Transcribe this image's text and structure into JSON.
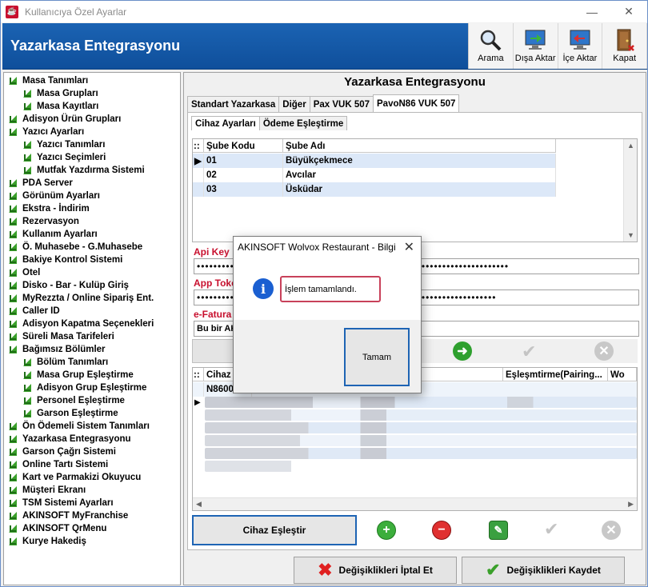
{
  "window": {
    "title": "Kullanıcıya Özel Ayarlar"
  },
  "header": {
    "title": "Yazarkasa Entegrasyonu"
  },
  "toolbar": {
    "search": "Arama",
    "export": "Dışa Aktar",
    "import": "İçe Aktar",
    "close": "Kapat"
  },
  "tree": [
    {
      "label": "Masa Tanımları",
      "level": 0
    },
    {
      "label": "Masa Grupları",
      "level": 1
    },
    {
      "label": "Masa Kayıtları",
      "level": 1
    },
    {
      "label": "Adisyon Ürün Grupları",
      "level": 0
    },
    {
      "label": "Yazıcı Ayarları",
      "level": 0
    },
    {
      "label": "Yazıcı Tanımları",
      "level": 1
    },
    {
      "label": "Yazıcı Seçimleri",
      "level": 1
    },
    {
      "label": "Mutfak Yazdırma Sistemi",
      "level": 1
    },
    {
      "label": "PDA Server",
      "level": 0
    },
    {
      "label": "Görünüm Ayarları",
      "level": 0
    },
    {
      "label": "Ekstra - İndirim",
      "level": 0
    },
    {
      "label": "Rezervasyon",
      "level": 0
    },
    {
      "label": "Kullanım Ayarları",
      "level": 0
    },
    {
      "label": "Ö. Muhasebe - G.Muhasebe",
      "level": 0
    },
    {
      "label": "Bakiye Kontrol Sistemi",
      "level": 0
    },
    {
      "label": "Otel",
      "level": 0
    },
    {
      "label": "Disko - Bar - Kulüp Giriş",
      "level": 0
    },
    {
      "label": "MyRezzta / Online Sipariş Ent.",
      "level": 0
    },
    {
      "label": "Caller ID",
      "level": 0
    },
    {
      "label": "Adisyon Kapatma Seçenekleri",
      "level": 0
    },
    {
      "label": "Süreli Masa Tarifeleri",
      "level": 0
    },
    {
      "label": "Bağımsız Bölümler",
      "level": 0
    },
    {
      "label": "Bölüm Tanımları",
      "level": 1
    },
    {
      "label": "Masa Grup Eşleştirme",
      "level": 1
    },
    {
      "label": "Adisyon Grup Eşleştirme",
      "level": 1
    },
    {
      "label": "Personel Eşleştirme",
      "level": 1
    },
    {
      "label": "Garson Eşleştirme",
      "level": 1
    },
    {
      "label": "Ön Ödemeli Sistem Tanımları",
      "level": 0
    },
    {
      "label": "Yazarkasa Entegrasyonu",
      "level": 0
    },
    {
      "label": "Garson Çağrı Sistemi",
      "level": 0
    },
    {
      "label": "Online Tartı Sistemi",
      "level": 0
    },
    {
      "label": "Kart ve Parmakizi Okuyucu",
      "level": 0
    },
    {
      "label": "Müşteri Ekranı",
      "level": 0
    },
    {
      "label": "TSM Sistemi Ayarları",
      "level": 0
    },
    {
      "label": "AKINSOFT MyFranchise",
      "level": 0
    },
    {
      "label": "AKINSOFT QrMenu",
      "level": 0
    },
    {
      "label": "Kurye Hakediş",
      "level": 0
    }
  ],
  "main": {
    "title": "Yazarkasa Entegrasyonu",
    "tabs": [
      "Standart Yazarkasa",
      "Diğer",
      "Pax VUK 507",
      "PavoN86 VUK 507"
    ],
    "subtabs": [
      "Cihaz Ayarları",
      "Ödeme Eşleştirme"
    ],
    "grid1": {
      "marker": "::",
      "columns": [
        "Şube Kodu",
        "Şube Adı"
      ],
      "rows": [
        [
          "01",
          "Büyükçekmece"
        ],
        [
          "02",
          "Avcılar"
        ],
        [
          "03",
          "Üsküdar"
        ]
      ]
    },
    "api_key_label": "Api Key",
    "api_key_value": "•••••••••••••••••••••••••••••••••••••••••••••••••••••••••••••••••••••••••••",
    "app_token_label": "App Toke",
    "app_token_value": "••••••••••••••••••••••••••••••••••••••••••••••••••••••••••••••••••••••••",
    "efatura_label": "e-Fatura",
    "efatura_value": "Bu bir AK",
    "grid2": {
      "marker": "::",
      "columns": [
        "Cihaz S",
        "Eşleşmtirme(Pairing...",
        "Wo"
      ],
      "first_cell": "N8600"
    },
    "pair_button": "Cihaz Eşleştir",
    "cancel_button": "Değişiklikleri İptal Et",
    "save_button": "Değişiklikleri Kaydet"
  },
  "dialog": {
    "title": "AKINSOFT Wolvox Restaurant - Bilgi",
    "close": "✕",
    "icon": "i",
    "message": "İşlem tamamlandı.",
    "ok": "Tamam"
  },
  "colors": {
    "header": "#1b63b3",
    "accent": "#c8102e",
    "selection": "#dce8f8"
  }
}
